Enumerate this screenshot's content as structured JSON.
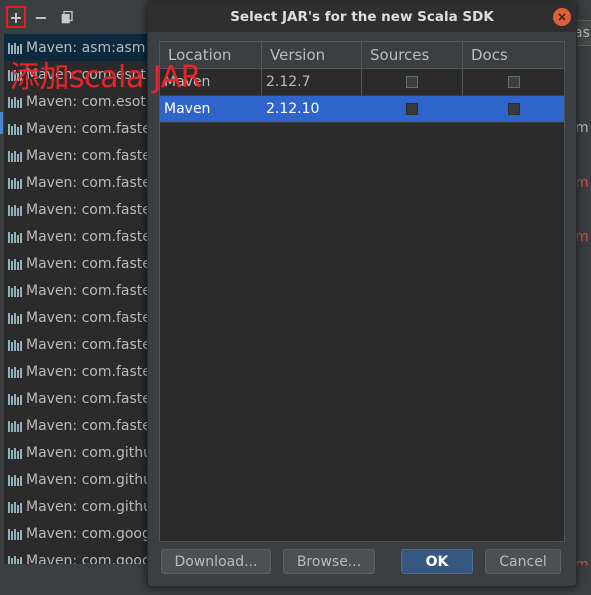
{
  "background": {
    "toolbar": {
      "add": "+",
      "remove": "−"
    },
    "annotation": "添加scala JAR",
    "libraries": [
      "Maven: asm:asm:",
      "Maven: com.esot",
      "Maven: com.esot",
      "Maven: com.faste",
      "Maven: com.faste",
      "Maven: com.faste",
      "Maven: com.faste",
      "Maven: com.faste",
      "Maven: com.faste",
      "Maven: com.faste",
      "Maven: com.faste",
      "Maven: com.faste",
      "Maven: com.faste",
      "Maven: com.faste",
      "Maven: com.faste",
      "Maven: com.githu",
      "Maven: com.githu",
      "Maven: com.githu",
      "Maven: com.goog",
      "Maven: com.goog",
      "Maven: com.goog"
    ],
    "right_field_text": "asm:",
    "right_strip": [
      {
        "text": "m",
        "color": "#bbbbbb"
      },
      {
        "text": "m",
        "color": "#d25252"
      },
      {
        "text": "m",
        "color": "#d25252"
      },
      {
        "text": "m",
        "color": "#d25252"
      }
    ]
  },
  "dialog": {
    "title": "Select JAR's for the new Scala SDK",
    "columns": [
      "Location",
      "Version",
      "Sources",
      "Docs"
    ],
    "rows": [
      {
        "location": "Maven",
        "version": "2.12.7",
        "sources": false,
        "docs": false,
        "selected": false
      },
      {
        "location": "Maven",
        "version": "2.12.10",
        "sources": true,
        "docs": true,
        "selected": true
      }
    ],
    "buttons": {
      "download": "Download...",
      "browse": "Browse...",
      "ok": "OK",
      "cancel": "Cancel"
    }
  },
  "colors": {
    "accent": "#2f65ca",
    "ok_button": "#365880",
    "annotation": "#e8242a",
    "close": "#e05f3b"
  }
}
